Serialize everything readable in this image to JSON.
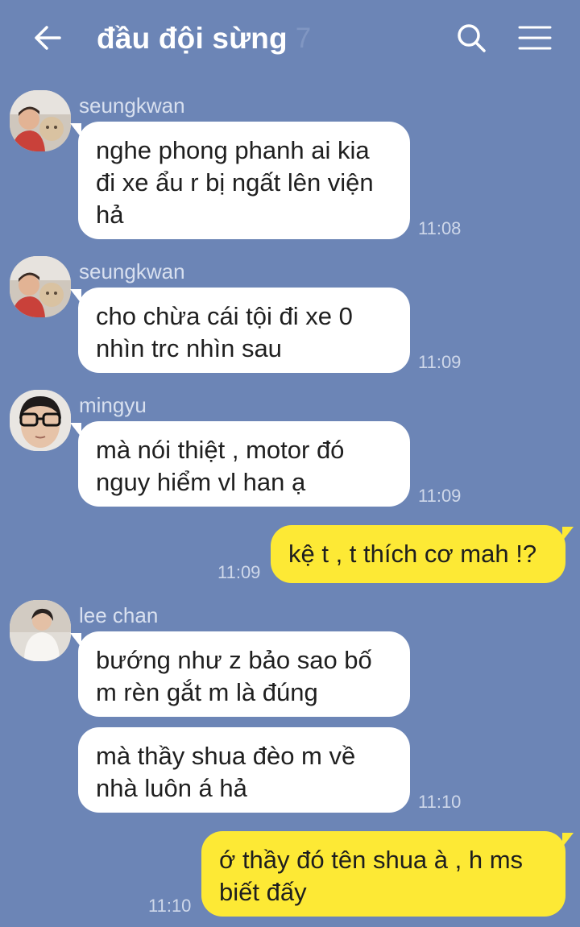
{
  "header": {
    "back_icon": "arrow-left-icon",
    "title": "đầu đội sừng",
    "member_count": "7",
    "search_icon": "search-icon",
    "menu_icon": "hamburger-menu-icon"
  },
  "colors": {
    "background": "#6c85b6",
    "incoming_bubble": "#ffffff",
    "outgoing_bubble": "#fde935"
  },
  "messages": [
    {
      "sender": "seungkwan",
      "lines": [
        "nghe phong phanh ai kia",
        "đi xe ẩu r bị ngất lên viện",
        "hả"
      ],
      "time": "11:08"
    },
    {
      "sender": "seungkwan",
      "lines": [
        "cho chừa cái tội đi xe 0",
        "nhìn trc nhìn sau"
      ],
      "time": "11:09"
    },
    {
      "sender": "mingyu",
      "lines": [
        "mà nói thiệt , motor đó",
        "nguy hiểm vl han ạ"
      ],
      "time": "11:09"
    },
    {
      "sender": "me",
      "lines": [
        "kệ t , t thích cơ mah !?"
      ],
      "time": "11:09"
    },
    {
      "sender": "lee chan",
      "lines": [
        "bướng như z bảo sao bố",
        "m rèn gắt m là đúng"
      ]
    },
    {
      "sender": "lee chan",
      "lines": [
        "mà thầy shua đèo m về",
        "nhà luôn á hả"
      ],
      "time": "11:10"
    },
    {
      "sender": "me",
      "lines": [
        "ớ thầy đó tên shua à , h ms",
        "biết đấy"
      ],
      "time": "11:10"
    }
  ]
}
